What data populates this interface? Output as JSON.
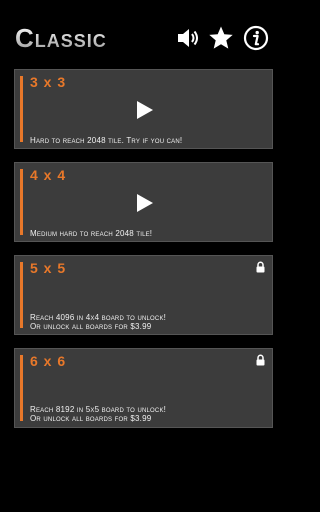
{
  "header": {
    "title": "Classic",
    "icons": [
      "speaker-icon",
      "star-icon",
      "info-icon"
    ]
  },
  "boards": [
    {
      "size": "3 x 3",
      "description": "Hard to reach 2048 tile. Try if you can!",
      "locked": false
    },
    {
      "size": "4 x 4",
      "description": "Medium hard to reach 2048 tile!",
      "locked": false
    },
    {
      "size": "5 x 5",
      "line1": "Reach 4096 in 4x4 board to unlock!",
      "line2": "Or unlock all boards for $3.99",
      "locked": true
    },
    {
      "size": "6 x 6",
      "line1": "Reach 8192 in 5x5 board to unlock!",
      "line2": "Or unlock all boards for $3.99",
      "locked": true
    }
  ],
  "colors": {
    "accent": "#e8782a",
    "card": "#3c3c3c",
    "background": "#000000"
  }
}
